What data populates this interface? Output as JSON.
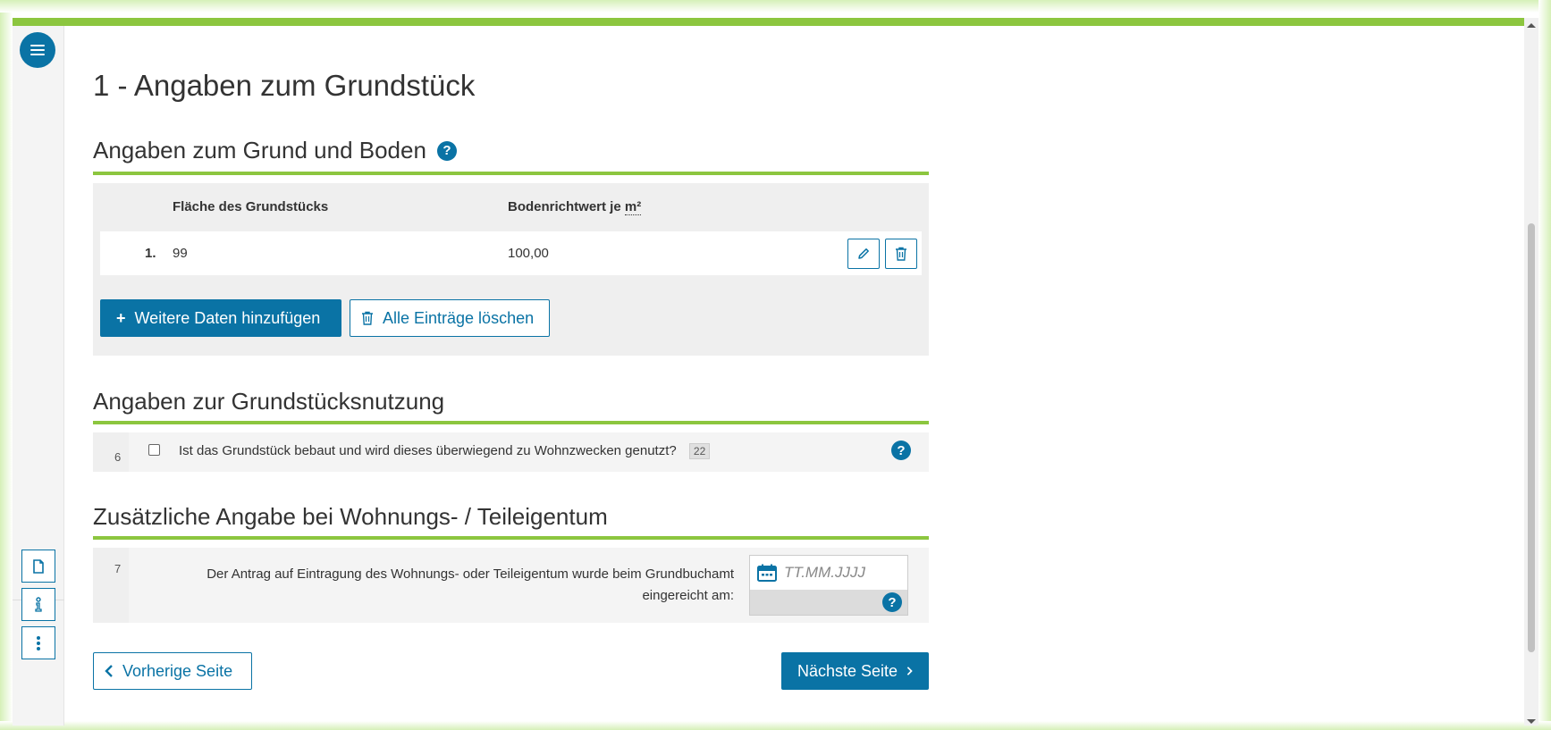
{
  "page": {
    "title": "1 - Angaben zum Grundstück"
  },
  "sections": {
    "grund_boden": {
      "title": "Angaben zum Grund und Boden",
      "help": "?",
      "columns": [
        "Fläche des Grundstücks",
        "Bodenrichtwert je"
      ],
      "column_unit": "m²",
      "rows": [
        {
          "index": "1.",
          "flaeche": "99",
          "bodenrichtwert": "100,00"
        }
      ],
      "add_label": "Weitere Daten hinzufügen",
      "add_prefix": "+",
      "delete_all_label": "Alle Einträge löschen"
    },
    "nutzung": {
      "title": "Angaben zur Grundstücksnutzung",
      "question_number": "6",
      "question_text": "Ist das Grundstück bebaut und wird dieses überwiegend zu Wohnzwecken genutzt?",
      "badge": "22",
      "checked": false,
      "help": "?"
    },
    "eigentum": {
      "title": "Zusätzliche Angabe bei Wohnungs- / Teileigentum",
      "question_number": "7",
      "question_text": "Der Antrag auf Eintragung des Wohnungs- oder Teileigentum wurde beim Grundbuchamt eingereicht am:",
      "date_placeholder": "TT.MM.JJJJ",
      "help": "?"
    }
  },
  "navigation": {
    "prev_label": "Vorherige Seite",
    "next_label": "Nächste Seite"
  },
  "colors": {
    "accent_green": "#8cc63f",
    "primary_blue": "#0a73a5"
  },
  "icons": {
    "menu": "hamburger-icon",
    "document": "document-icon",
    "info": "info-person-icon",
    "more": "more-vertical-icon",
    "edit": "pencil-icon",
    "delete": "trash-icon",
    "calendar": "calendar-icon",
    "prev": "chevron-left-icon",
    "next": "chevron-right-icon"
  }
}
